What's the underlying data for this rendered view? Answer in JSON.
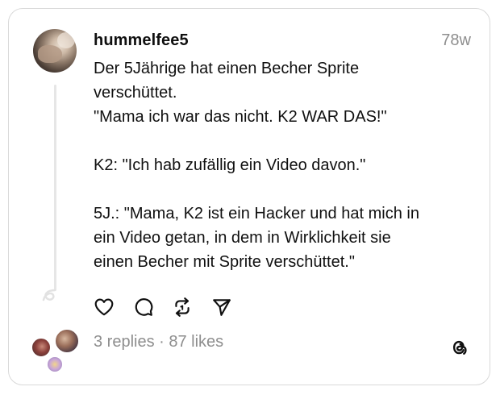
{
  "post": {
    "username": "hummelfee5",
    "timestamp": "78w",
    "lines": [
      "Der 5Jährige hat einen Becher Sprite",
      "verschüttet.",
      "\"Mama ich war das nicht. K2 WAR DAS!\"",
      "",
      "K2: \"Ich hab zufällig ein Video davon.\"",
      "",
      "5J.: \"Mama, K2 ist ein Hacker und hat mich in",
      "ein Video getan, in dem in Wirklichkeit sie",
      "einen Becher mit Sprite verschüttet.\""
    ]
  },
  "actions": [
    {
      "name": "like-icon"
    },
    {
      "name": "comment-icon"
    },
    {
      "name": "repost-icon"
    },
    {
      "name": "share-icon"
    }
  ],
  "stats": {
    "summary": "3 replies · 87 likes"
  },
  "colors": {
    "text": "#101010",
    "muted": "#8e8e8e",
    "border": "#d9d9d9",
    "thread_line": "#e6e6e6"
  },
  "icons": {
    "brand": "threads-logo-icon"
  }
}
